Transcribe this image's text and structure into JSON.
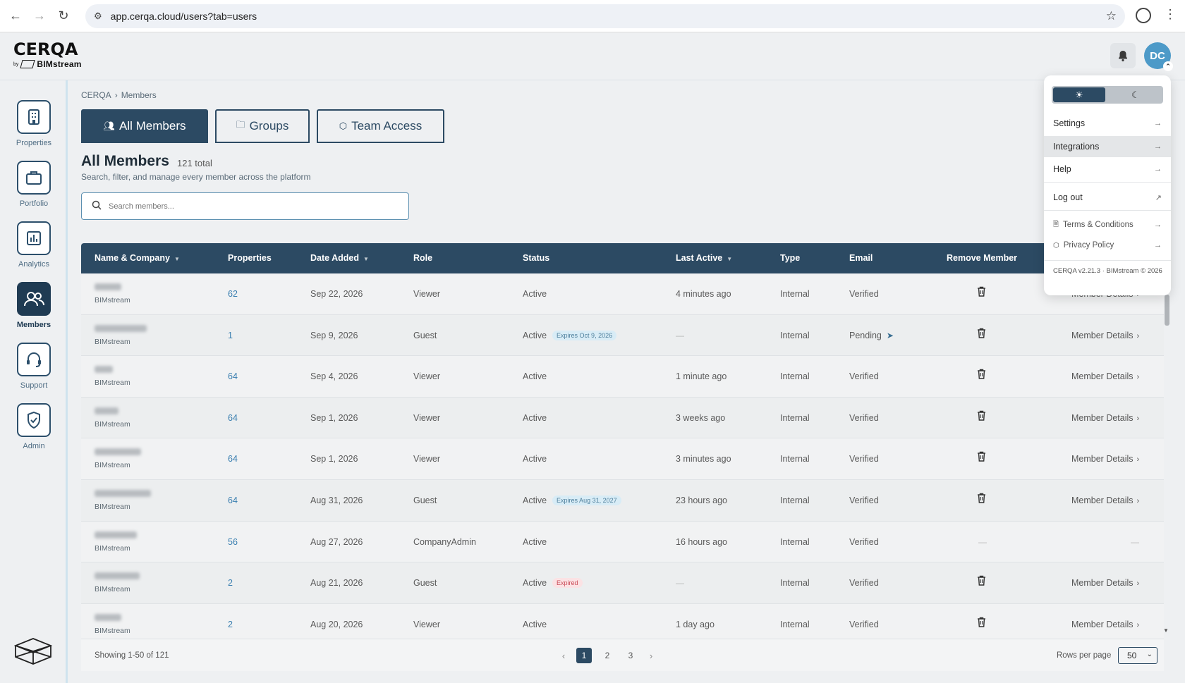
{
  "browser": {
    "url": "app.cerqa.cloud/users?tab=users"
  },
  "header": {
    "logo_main": "CERQA",
    "logo_by": "by",
    "logo_sub": "BIMstream",
    "avatar_initials": "DC"
  },
  "sidebar": {
    "items": [
      {
        "label": "Properties",
        "icon": "building-icon"
      },
      {
        "label": "Portfolio",
        "icon": "briefcase-icon"
      },
      {
        "label": "Analytics",
        "icon": "bar-chart-icon"
      },
      {
        "label": "Members",
        "icon": "users-icon",
        "active": true
      },
      {
        "label": "Support",
        "icon": "headset-icon"
      },
      {
        "label": "Admin",
        "icon": "shield-check-icon"
      }
    ]
  },
  "breadcrumb": {
    "root": "CERQA",
    "sep": "›",
    "current": "Members"
  },
  "tabs": [
    {
      "label": "All Members",
      "active": true
    },
    {
      "label": "Groups"
    },
    {
      "label": "Team Access"
    }
  ],
  "page": {
    "title": "All Members",
    "total": "121 total",
    "subtitle": "Search, filter, and manage every member across the platform",
    "search_placeholder": "Search members..."
  },
  "table": {
    "columns": [
      "Name & Company",
      "Properties",
      "Date Added",
      "Role",
      "Status",
      "Last Active",
      "Type",
      "Email",
      "Remove Member"
    ],
    "rows": [
      {
        "company": "BIMstream",
        "properties": "62",
        "date": "Sep 22, 2026",
        "role": "Viewer",
        "status": "Active",
        "badge": "",
        "last_active": "4 minutes ago",
        "type": "Internal",
        "email": "Verified",
        "removable": true,
        "details": "Member Details"
      },
      {
        "company": "BIMstream",
        "properties": "1",
        "date": "Sep 9, 2026",
        "role": "Guest",
        "status": "Active",
        "badge": "Expires Oct 9, 2026",
        "last_active": "—",
        "type": "Internal",
        "email": "Pending",
        "removable": true,
        "details": "Member Details"
      },
      {
        "company": "BIMstream",
        "properties": "64",
        "date": "Sep 4, 2026",
        "role": "Viewer",
        "status": "Active",
        "badge": "",
        "last_active": "1 minute ago",
        "type": "Internal",
        "email": "Verified",
        "removable": true,
        "details": "Member Details"
      },
      {
        "company": "BIMstream",
        "properties": "64",
        "date": "Sep 1, 2026",
        "role": "Viewer",
        "status": "Active",
        "badge": "",
        "last_active": "3 weeks ago",
        "type": "Internal",
        "email": "Verified",
        "removable": true,
        "details": "Member Details"
      },
      {
        "company": "BIMstream",
        "properties": "64",
        "date": "Sep 1, 2026",
        "role": "Viewer",
        "status": "Active",
        "badge": "",
        "last_active": "3 minutes ago",
        "type": "Internal",
        "email": "Verified",
        "removable": true,
        "details": "Member Details"
      },
      {
        "company": "BIMstream",
        "properties": "64",
        "date": "Aug 31, 2026",
        "role": "Guest",
        "status": "Active",
        "badge": "Expires Aug 31, 2027",
        "last_active": "23 hours ago",
        "type": "Internal",
        "email": "Verified",
        "removable": true,
        "details": "Member Details"
      },
      {
        "company": "BIMstream",
        "properties": "56",
        "date": "Aug 27, 2026",
        "role": "CompanyAdmin",
        "status": "Active",
        "badge": "",
        "last_active": "16 hours ago",
        "type": "Internal",
        "email": "Verified",
        "removable": false,
        "details": "—"
      },
      {
        "company": "BIMstream",
        "properties": "2",
        "date": "Aug 21, 2026",
        "role": "Guest",
        "status": "Active",
        "badge": "Expired",
        "last_active": "—",
        "type": "Internal",
        "email": "Verified",
        "removable": true,
        "details": "Member Details"
      },
      {
        "company": "BIMstream",
        "properties": "2",
        "date": "Aug 20, 2026",
        "role": "Viewer",
        "status": "Active",
        "badge": "",
        "last_active": "1 day ago",
        "type": "Internal",
        "email": "Verified",
        "removable": true,
        "details": "Member Details"
      }
    ]
  },
  "footer": {
    "showing": "Showing 1-50 of 121",
    "pages": [
      "1",
      "2",
      "3"
    ],
    "current_page": "1",
    "prev": "‹",
    "next": "›",
    "rows_per_page_label": "Rows per page",
    "rows_per_page_value": "50"
  },
  "dropdown": {
    "items": [
      {
        "label": "Settings",
        "arrow": "→"
      },
      {
        "label": "Integrations",
        "arrow": "→"
      },
      {
        "label": "Help",
        "arrow": "→"
      },
      {
        "label": "Log out",
        "arrow": "↗"
      },
      {
        "label": "Terms & Conditions",
        "arrow": "→"
      },
      {
        "label": "Privacy Policy",
        "arrow": "→"
      }
    ],
    "version": "CERQA v2.21.3 · BIMstream © 2026"
  },
  "colors": {
    "primary": "#2c4a63",
    "avatar": "#4d9ac8",
    "link": "#3a7fb0",
    "expired": "#c94a56"
  }
}
